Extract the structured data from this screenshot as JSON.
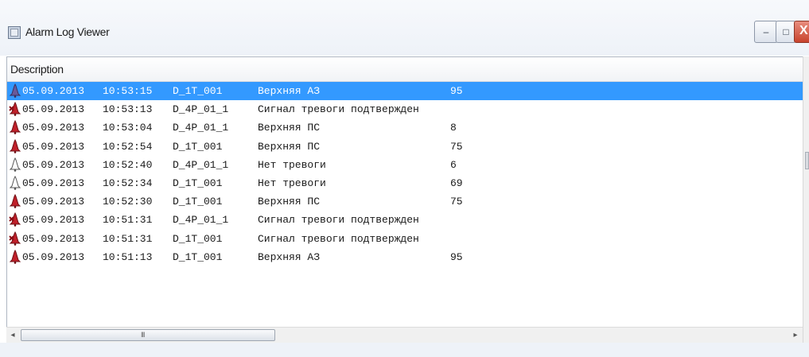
{
  "window": {
    "title": "Alarm Log Viewer",
    "buttons": {
      "minimize": "–",
      "maximize": "□",
      "close": "X"
    }
  },
  "list": {
    "column_header": "Description",
    "rows": [
      {
        "icon": "alarm-active-bell-icon",
        "date": "05.09.2013",
        "time": "10:53:15",
        "tag": "D_1T_001",
        "desc": "Верхняя АЗ",
        "value": "95",
        "selected": true
      },
      {
        "icon": "alarm-ack-bell-icon",
        "date": "05.09.2013",
        "time": "10:53:13",
        "tag": "D_4P_01_1",
        "desc": "Сигнал тревоги подтвержден",
        "value": ""
      },
      {
        "icon": "alarm-active-bell-icon",
        "date": "05.09.2013",
        "time": "10:53:04",
        "tag": "D_4P_01_1",
        "desc": "Верхняя ПС",
        "value": "8"
      },
      {
        "icon": "alarm-active-bell-icon",
        "date": "05.09.2013",
        "time": "10:52:54",
        "tag": "D_1T_001",
        "desc": "Верхняя ПС",
        "value": "75"
      },
      {
        "icon": "alarm-cleared-bell-icon",
        "date": "05.09.2013",
        "time": "10:52:40",
        "tag": "D_4P_01_1",
        "desc": "Нет тревоги",
        "value": "6"
      },
      {
        "icon": "alarm-cleared-bell-icon",
        "date": "05.09.2013",
        "time": "10:52:34",
        "tag": "D_1T_001",
        "desc": "Нет тревоги",
        "value": "69"
      },
      {
        "icon": "alarm-active-bell-icon",
        "date": "05.09.2013",
        "time": "10:52:30",
        "tag": "D_1T_001",
        "desc": "Верхняя ПС",
        "value": "75"
      },
      {
        "icon": "alarm-ack-bell-icon",
        "date": "05.09.2013",
        "time": "10:51:31",
        "tag": "D_4P_01_1",
        "desc": "Сигнал тревоги подтвержден",
        "value": ""
      },
      {
        "icon": "alarm-ack-bell-icon",
        "date": "05.09.2013",
        "time": "10:51:31",
        "tag": "D_1T_001",
        "desc": "Сигнал тревоги подтвержден",
        "value": ""
      },
      {
        "icon": "alarm-active-bell-icon",
        "date": "05.09.2013",
        "time": "10:51:13",
        "tag": "D_1T_001",
        "desc": "Верхняя АЗ",
        "value": "95"
      }
    ]
  },
  "scrollbar": {
    "grip": "III",
    "left_arrow": "◂",
    "right_arrow": "▸"
  },
  "colors": {
    "selection": "#3399ff",
    "bell_active": "#c0202a",
    "bell_selected": "#6a5a9a",
    "bell_cleared": "#ffffff"
  }
}
